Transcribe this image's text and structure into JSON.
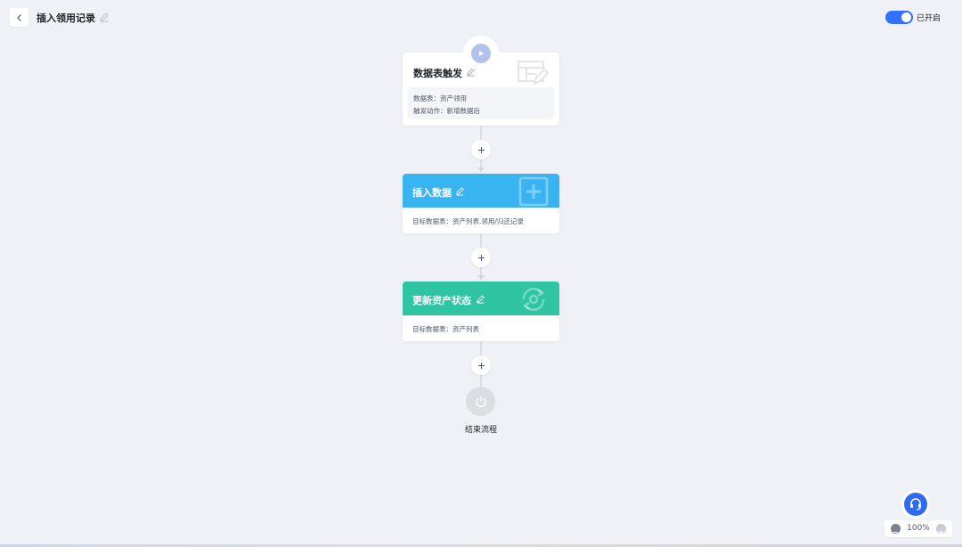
{
  "header": {
    "title": "插入领用记录"
  },
  "toggle": {
    "label": "已开启",
    "on": true
  },
  "trigger": {
    "title": "数据表触发",
    "rows": [
      "数据表：资产领用",
      "触发动作：新增数据后"
    ]
  },
  "steps": [
    {
      "title": "插入数据",
      "detail": "目标数据表：资产列表.领用/归还记录",
      "color": "#3ab4f0",
      "icon": "plus-square-icon"
    },
    {
      "title": "更新资产状态",
      "detail": "目标数据表：资产列表",
      "color": "#2fc5a2",
      "icon": "refresh-gear-icon"
    }
  ],
  "end": {
    "label": "结束流程"
  },
  "zoom": {
    "value": "100%"
  }
}
